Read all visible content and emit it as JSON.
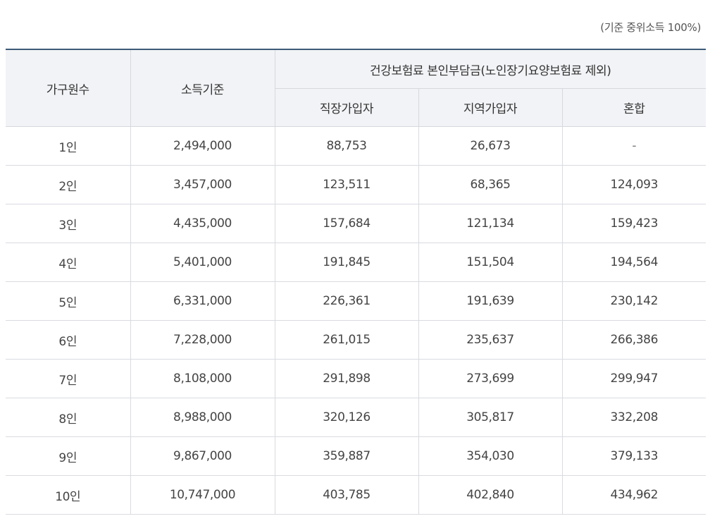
{
  "note": "(기준 중위소득 100%)",
  "headers": {
    "household": "가구원수",
    "income": "소득기준",
    "premium_group": "건강보험료 본인부담금(노인장기요양보험료 제외)",
    "employee": "직장가입자",
    "regional": "지역가입자",
    "mixed": "혼합"
  },
  "rows": [
    {
      "household": "1인",
      "income": "2,494,000",
      "employee": "88,753",
      "regional": "26,673",
      "mixed": "-"
    },
    {
      "household": "2인",
      "income": "3,457,000",
      "employee": "123,511",
      "regional": "68,365",
      "mixed": "124,093"
    },
    {
      "household": "3인",
      "income": "4,435,000",
      "employee": "157,684",
      "regional": "121,134",
      "mixed": "159,423"
    },
    {
      "household": "4인",
      "income": "5,401,000",
      "employee": "191,845",
      "regional": "151,504",
      "mixed": "194,564"
    },
    {
      "household": "5인",
      "income": "6,331,000",
      "employee": "226,361",
      "regional": "191,639",
      "mixed": "230,142"
    },
    {
      "household": "6인",
      "income": "7,228,000",
      "employee": "261,015",
      "regional": "235,637",
      "mixed": "266,386"
    },
    {
      "household": "7인",
      "income": "8,108,000",
      "employee": "291,898",
      "regional": "273,699",
      "mixed": "299,947"
    },
    {
      "household": "8인",
      "income": "8,988,000",
      "employee": "320,126",
      "regional": "305,817",
      "mixed": "332,208"
    },
    {
      "household": "9인",
      "income": "9,867,000",
      "employee": "359,887",
      "regional": "354,030",
      "mixed": "379,133"
    },
    {
      "household": "10인",
      "income": "10,747,000",
      "employee": "403,785",
      "regional": "402,840",
      "mixed": "434,962"
    }
  ]
}
